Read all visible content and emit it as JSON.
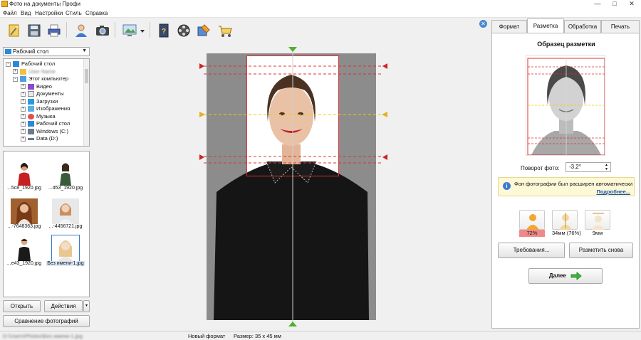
{
  "window": {
    "title": "Фото на документы Профи",
    "minimize": "—",
    "maximize": "□",
    "close": "✕"
  },
  "menu": [
    "Файл",
    "Вид",
    "Настройки",
    "Стиль",
    "Справка"
  ],
  "toolbar": {
    "icons": [
      "new-wand-icon",
      "save-icon",
      "print-icon",
      "user-icon",
      "camera-icon",
      "monitor-icon",
      "dropdown-arrow-icon",
      "book-icon",
      "film-icon",
      "puzzle-icon",
      "cart-icon"
    ],
    "close_label": "✕"
  },
  "left": {
    "folder": "Рабочий стол",
    "tree": [
      {
        "label": "Рабочий стол",
        "indent": 0,
        "exp": "-"
      },
      {
        "label": "User Name",
        "indent": 1,
        "exp": "+",
        "blurred": true
      },
      {
        "label": "Этот компьютер",
        "indent": 1,
        "exp": "-"
      },
      {
        "label": "Видео",
        "indent": 2,
        "exp": "+"
      },
      {
        "label": "Документы",
        "indent": 2,
        "exp": "+"
      },
      {
        "label": "Загрузки",
        "indent": 2,
        "exp": "+"
      },
      {
        "label": "Изображения",
        "indent": 2,
        "exp": "+"
      },
      {
        "label": "Музыка",
        "indent": 2,
        "exp": "+"
      },
      {
        "label": "Рабочий стол",
        "indent": 2,
        "exp": "+"
      },
      {
        "label": "Windows (C:)",
        "indent": 2,
        "exp": "+"
      },
      {
        "label": "Data (D:)",
        "indent": 2,
        "exp": "+"
      }
    ],
    "thumbs": [
      {
        "caption": "...5c8_1920.jpg"
      },
      {
        "caption": "...d53_1920.jpg"
      },
      {
        "caption": "...-7648363.jpg"
      },
      {
        "caption": "...-4456721.jpg"
      },
      {
        "caption": "...e43_1920.jpg"
      },
      {
        "caption": "Без имени-1.jpg",
        "selected": true
      }
    ],
    "open": "Открыть",
    "actions": "Действия",
    "actions_caret": "▾",
    "compare": "Сравнение фотографий"
  },
  "right": {
    "tabs": [
      {
        "label": "Формат",
        "active": false
      },
      {
        "label": "Разметка",
        "active": true
      },
      {
        "label": "Обработка",
        "active": false
      },
      {
        "label": "Печать",
        "active": false
      }
    ],
    "sample_title": "Образец разметки",
    "rotate_label": "Поворот фото:",
    "rotate_value": "-3,2°",
    "info_message": "Фон фотографии был расширен автоматически",
    "info_more": "Подробнее...",
    "meters": [
      {
        "value": "72%",
        "icon": "face-ratio-icon",
        "status": "error"
      },
      {
        "value": "34мм (76%)",
        "icon": "head-height-icon",
        "status": "ok"
      },
      {
        "value": "9мм",
        "icon": "top-margin-icon",
        "status": "ok"
      }
    ],
    "requirements": "Требования...",
    "remark": "Разметить снова",
    "next": "Далее"
  },
  "status": {
    "path": "D:\\Users\\Photos\\Без имени-1.jpg",
    "format": "Новый формат",
    "size": "Размер: 35 х 45 мм"
  },
  "colors": {
    "accent": "#3a7ad0",
    "guide_red": "#e03030",
    "guide_yellow": "#e8d000",
    "next_arrow": "#3cb83c"
  }
}
